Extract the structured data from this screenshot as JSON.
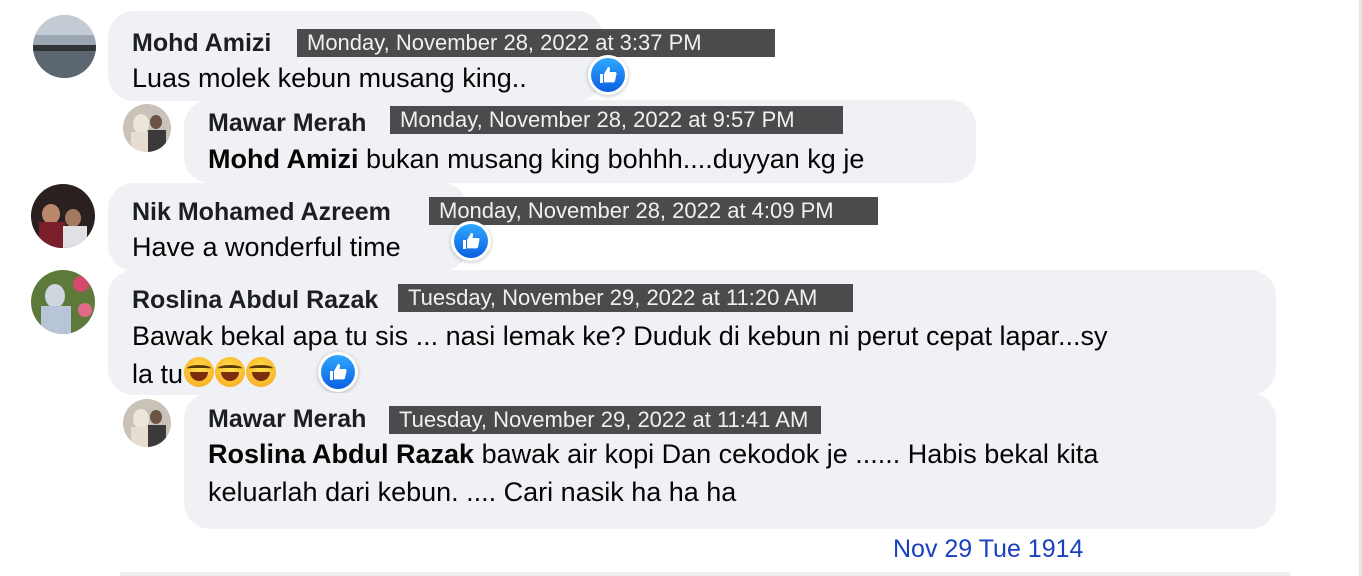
{
  "comments": [
    {
      "name": "Mohd Amizi",
      "timestamp": "Monday, November 28, 2022 at 3:37 PM",
      "text": "Luas molek kebun musang king..",
      "reaction_icon": "like-icon"
    },
    {
      "name": "Mawar Merah",
      "timestamp": "Monday, November 28, 2022 at 9:57 PM",
      "mention": "Mohd Amizi",
      "text": "bukan musang king bohhh....duyyan kg je"
    },
    {
      "name": "Nik Mohamed Azreem",
      "timestamp": "Monday, November 28, 2022 at 4:09 PM",
      "text": "Have a wonderful time",
      "reaction_icon": "like-icon"
    },
    {
      "name": "Roslina Abdul Razak",
      "timestamp": "Tuesday, November 29, 2022 at 11:20 AM",
      "text_line1": "Bawak bekal apa tu sis ... nasi lemak ke? Duduk di kebun ni perut cepat lapar...sy",
      "text_line2": "la tu",
      "emoji_icons": [
        "tears-of-joy-emoji",
        "tears-of-joy-emoji",
        "tears-of-joy-emoji"
      ],
      "reaction_icon": "like-icon"
    },
    {
      "name": "Mawar Merah",
      "timestamp": "Tuesday, November 29, 2022 at 11:41 AM",
      "mention": "Roslina Abdul Razak",
      "text_line1": "bawak air kopi Dan cekodok je ...... Habis bekal kita",
      "text_line2": "keluarlah dari kebun. .... Cari nasik ha ha ha"
    }
  ],
  "handwritten_note": "Nov 29 Tue 1914",
  "colors": {
    "bubble": "#eff1f4",
    "timestamp_bg": "#4a4b4d",
    "like_blue": "#1877f2",
    "note_blue": "#1a3fbf"
  }
}
